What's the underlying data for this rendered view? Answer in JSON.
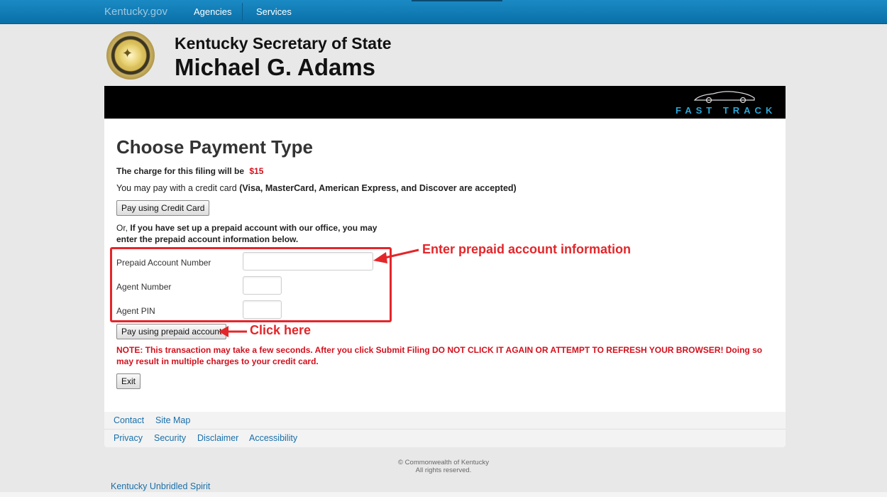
{
  "topbar": {
    "brand": "Kentucky.gov",
    "nav": [
      "Agencies",
      "Services"
    ]
  },
  "header": {
    "line1": "Kentucky Secretary of State",
    "line2": "Michael G. Adams"
  },
  "banner": {
    "logo_text": "FAST TRACK"
  },
  "main": {
    "title": "Choose Payment Type",
    "charge_text": "The charge for this filing will be",
    "charge_amount": "$15",
    "cc_text_normal": "You may pay with a credit card",
    "cc_text_bold": "(Visa, MasterCard, American Express, and Discover are accepted)",
    "cc_button": "Pay using Credit Card",
    "or_prefix": "Or,",
    "or_bold": "If you have set up a prepaid account with our office, you may enter the prepaid account information below.",
    "fields": {
      "account_label": "Prepaid Account Number",
      "agent_label": "Agent Number",
      "pin_label": "Agent PIN",
      "account_value": "",
      "agent_value": "",
      "pin_value": ""
    },
    "prepaid_button": "Pay using prepaid account",
    "note": "NOTE: This transaction may take a few seconds. After you click Submit Filing DO NOT CLICK IT AGAIN OR ATTEMPT TO REFRESH YOUR BROWSER! Doing so may result in multiple charges to your credit card.",
    "exit_button": "Exit"
  },
  "annotations": {
    "enter_info": "Enter prepaid account information",
    "click_here": "Click here"
  },
  "footer": {
    "row1": [
      "Contact",
      "Site Map"
    ],
    "row2": [
      "Privacy",
      "Security",
      "Disclaimer",
      "Accessibility"
    ],
    "copyright_line1": "© Commonwealth of Kentucky",
    "copyright_line2": "All rights reserved.",
    "spirit": "Kentucky Unbridled Spirit"
  },
  "colors": {
    "nav_blue": "#0a6fa7",
    "alert_red": "#d3101d",
    "annotation_red": "#e3262a",
    "link_blue": "#1a6fa8",
    "fast_track_blue": "#2aa8d8"
  }
}
